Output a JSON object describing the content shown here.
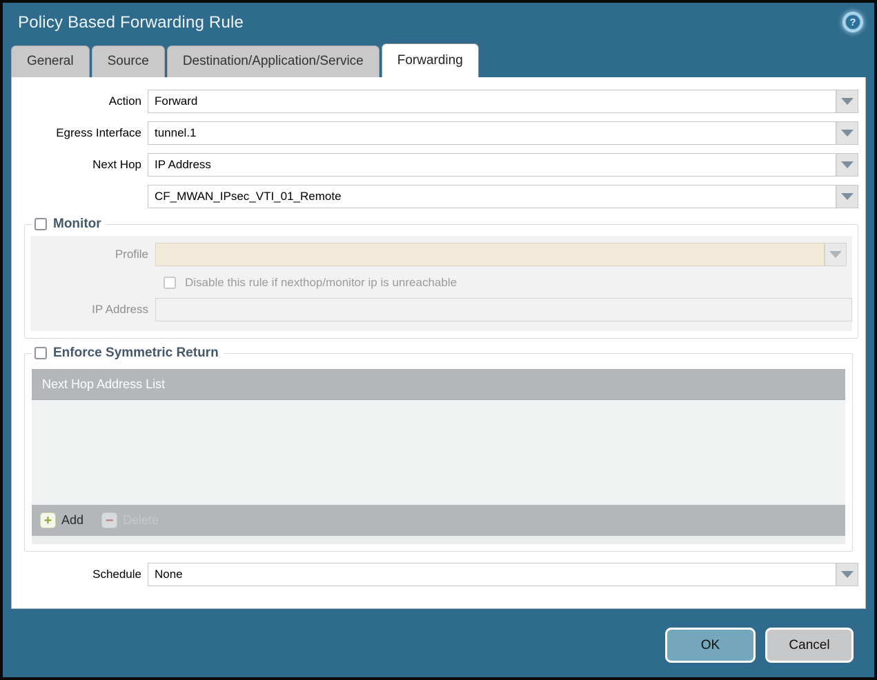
{
  "dialog": {
    "title": "Policy Based Forwarding Rule"
  },
  "icons": {
    "help_glyph": "?",
    "add_glyph": "+",
    "delete_glyph": "−"
  },
  "tabs": [
    {
      "label": "General",
      "active": false
    },
    {
      "label": "Source",
      "active": false
    },
    {
      "label": "Destination/Application/Service",
      "active": false
    },
    {
      "label": "Forwarding",
      "active": true
    }
  ],
  "form": {
    "action": {
      "label": "Action",
      "value": "Forward"
    },
    "egress_interface": {
      "label": "Egress Interface",
      "value": "tunnel.1"
    },
    "next_hop": {
      "label": "Next Hop",
      "value": "IP Address"
    },
    "next_hop_address": {
      "value": "CF_MWAN_IPsec_VTI_01_Remote"
    },
    "schedule": {
      "label": "Schedule",
      "value": "None"
    }
  },
  "monitor": {
    "legend": "Monitor",
    "checked": false,
    "profile": {
      "label": "Profile",
      "value": ""
    },
    "disable_rule_label": "Disable this rule if nexthop/monitor ip is unreachable",
    "ip_address": {
      "label": "IP Address",
      "value": ""
    }
  },
  "symmetric_return": {
    "legend": "Enforce Symmetric Return",
    "checked": false,
    "table_header": "Next Hop Address List",
    "add_label": "Add",
    "delete_label": "Delete"
  },
  "footer": {
    "ok_label": "OK",
    "cancel_label": "Cancel"
  },
  "colors": {
    "chrome_teal": "#2f6b8d",
    "tab_inactive": "#c9c9c9",
    "table_gray": "#b3b7b9",
    "profile_cream": "#f1ead8",
    "ok_button": "#74a7bb",
    "cancel_button": "#c7c8ca",
    "add_icon_green": "#96a43d",
    "delete_icon_red": "#bb7f83"
  }
}
